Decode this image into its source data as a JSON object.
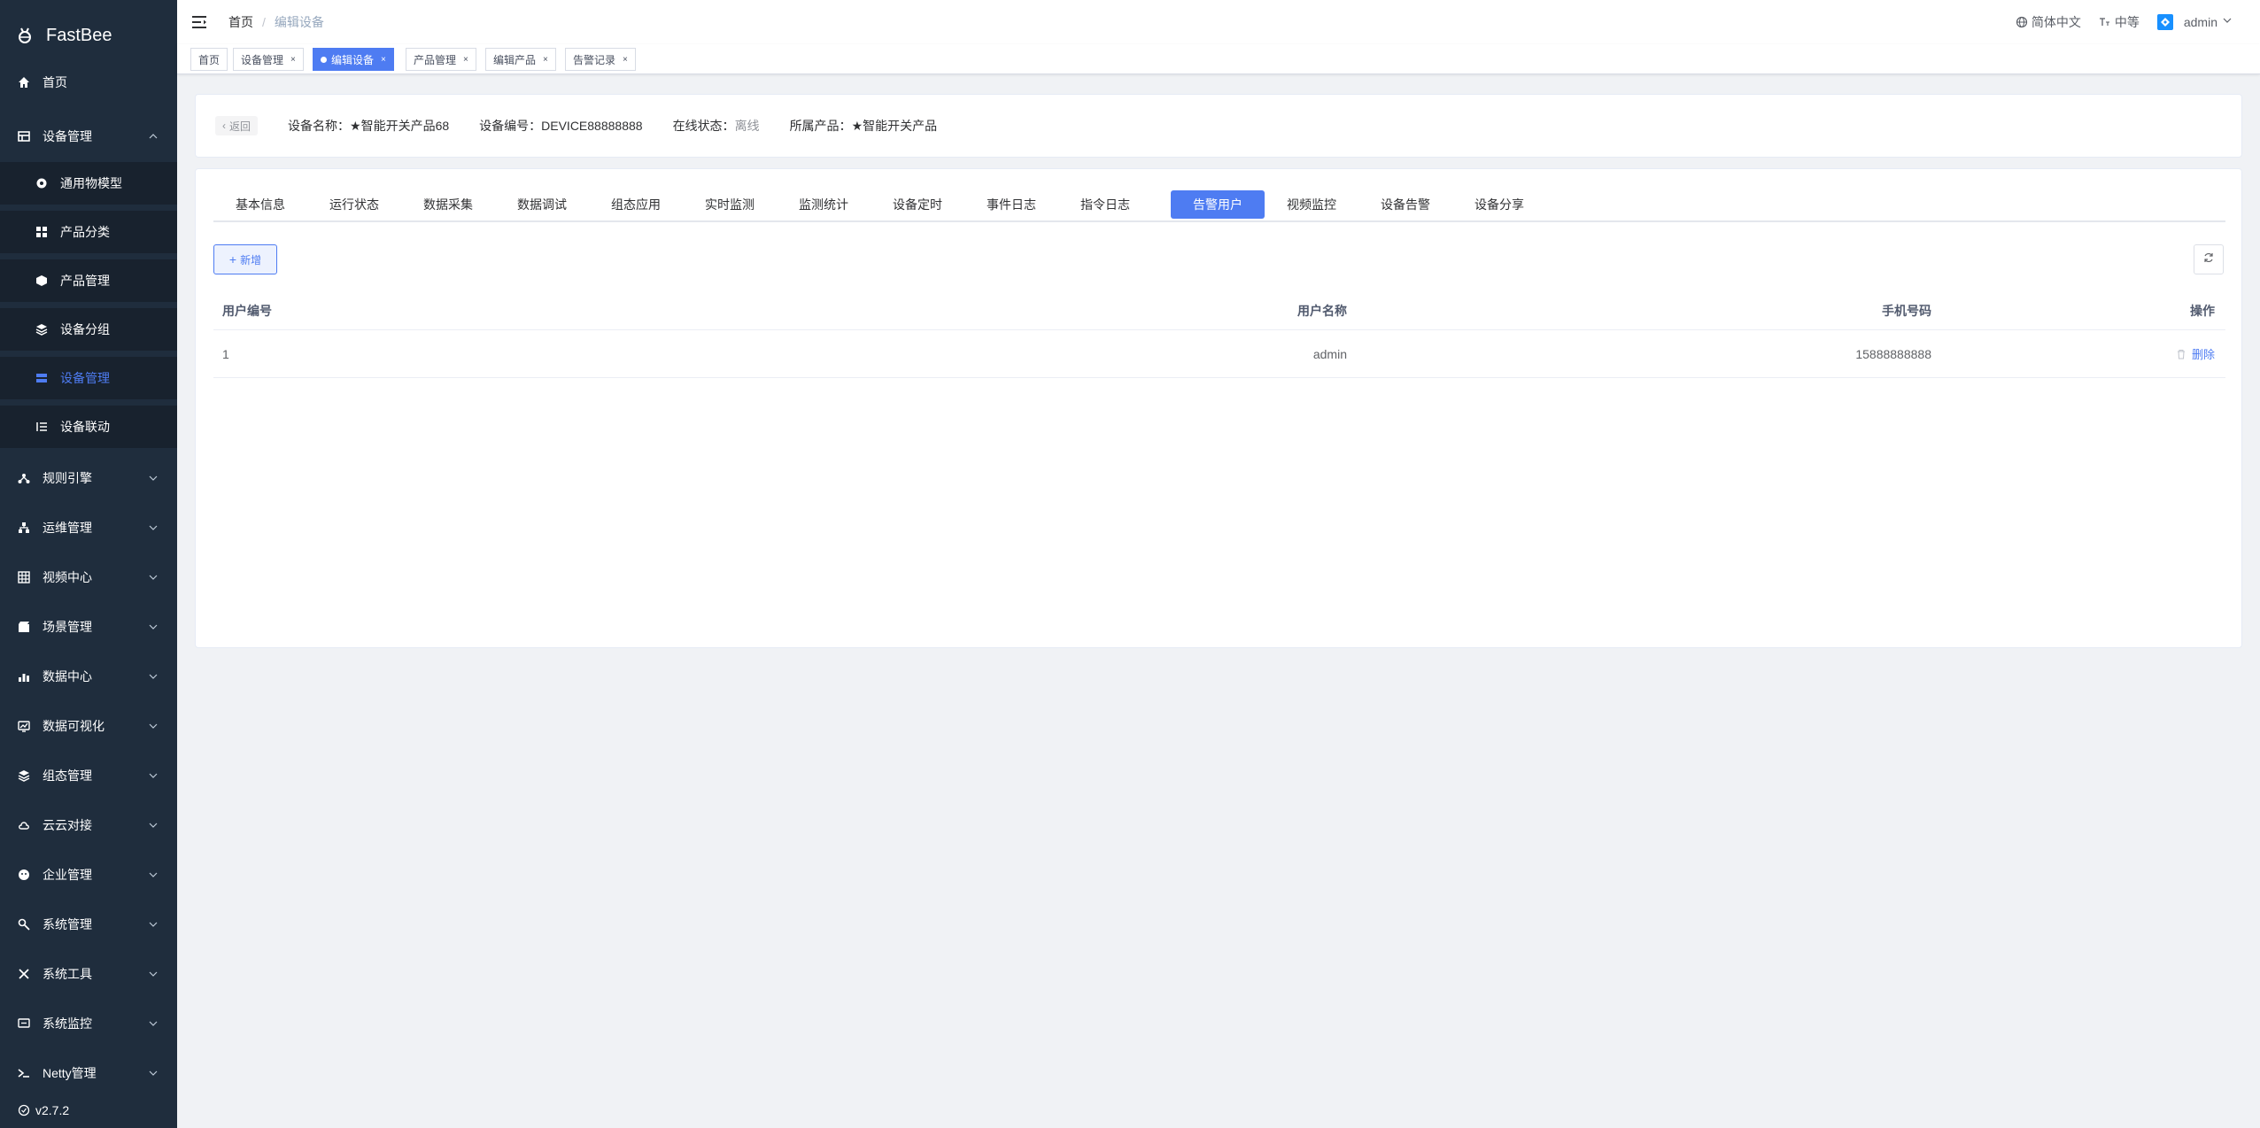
{
  "sidebar": {
    "logo_text": "FastBee",
    "version": "v2.7.2",
    "items": [
      {
        "label": "首页",
        "icon": "home-icon"
      },
      {
        "label": "设备管理",
        "icon": "device-icon",
        "expanded": true
      },
      {
        "label": "规则引擎",
        "icon": "rule-icon"
      },
      {
        "label": "运维管理",
        "icon": "ops-icon"
      },
      {
        "label": "视频中心",
        "icon": "video-icon"
      },
      {
        "label": "场景管理",
        "icon": "scene-icon"
      },
      {
        "label": "数据中心",
        "icon": "data-icon"
      },
      {
        "label": "数据可视化",
        "icon": "visual-icon"
      },
      {
        "label": "组态管理",
        "icon": "config-icon"
      },
      {
        "label": "云云对接",
        "icon": "cloud-icon"
      },
      {
        "label": "企业管理",
        "icon": "enterprise-icon"
      },
      {
        "label": "系统管理",
        "icon": "system-icon"
      },
      {
        "label": "系统工具",
        "icon": "tools-icon"
      },
      {
        "label": "系统监控",
        "icon": "monitor-icon"
      },
      {
        "label": "Netty管理",
        "icon": "netty-icon"
      }
    ],
    "subitems": [
      {
        "label": "通用物模型",
        "icon": "model-icon"
      },
      {
        "label": "产品分类",
        "icon": "category-icon"
      },
      {
        "label": "产品管理",
        "icon": "product-icon"
      },
      {
        "label": "设备分组",
        "icon": "group-icon"
      },
      {
        "label": "设备管理",
        "icon": "device-list-icon",
        "active": true
      },
      {
        "label": "设备联动",
        "icon": "linkage-icon"
      }
    ]
  },
  "navbar": {
    "breadcrumb_home": "首页",
    "breadcrumb_sep": "/",
    "breadcrumb_current": "编辑设备",
    "language": "简体中文",
    "size": "中等",
    "user": "admin"
  },
  "tags": [
    {
      "label": "首页"
    },
    {
      "label": "设备管理"
    },
    {
      "label": "编辑设备",
      "active": true
    },
    {
      "label": "产品管理"
    },
    {
      "label": "编辑产品"
    },
    {
      "label": "告警记录"
    }
  ],
  "device_info": {
    "back_label": "返回",
    "name_label": "设备名称：",
    "name_value": "★智能开关产品68",
    "serial_label": "设备编号：",
    "serial_value": "DEVICE88888888",
    "status_label": "在线状态：",
    "status_value": "离线",
    "product_label": "所属产品：",
    "product_value": "★智能开关产品"
  },
  "tabs": [
    {
      "label": "基本信息"
    },
    {
      "label": "运行状态"
    },
    {
      "label": "数据采集"
    },
    {
      "label": "数据调试"
    },
    {
      "label": "组态应用"
    },
    {
      "label": "实时监测"
    },
    {
      "label": "监测统计"
    },
    {
      "label": "设备定时"
    },
    {
      "label": "事件日志"
    },
    {
      "label": "指令日志"
    },
    {
      "label": "告警用户",
      "active": true
    },
    {
      "label": "视频监控"
    },
    {
      "label": "设备告警"
    },
    {
      "label": "设备分享"
    }
  ],
  "toolbar": {
    "add_label": "新增"
  },
  "table": {
    "headers": [
      "用户编号",
      "用户名称",
      "手机号码",
      "操作"
    ],
    "rows": [
      {
        "id": "1",
        "name": "admin",
        "phone": "15888888888",
        "action": "删除"
      }
    ]
  },
  "colors": {
    "sidebar_bg": "#1f2d3d",
    "accent": "#4e7cf2"
  }
}
